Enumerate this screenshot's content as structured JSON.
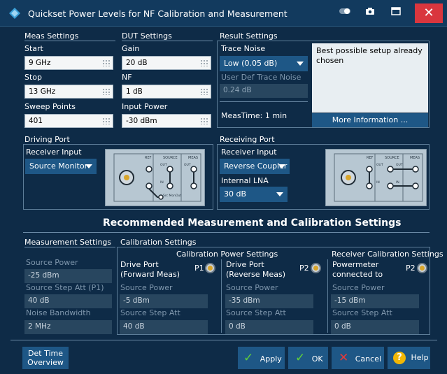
{
  "window": {
    "title": "Quickset Power Levels for NF Calibration and Measurement"
  },
  "meas": {
    "section": "Meas Settings",
    "start_label": "Start",
    "start_value": "9 GHz",
    "stop_label": "Stop",
    "stop_value": "13 GHz",
    "points_label": "Sweep Points",
    "points_value": "401"
  },
  "dut": {
    "section": "DUT Settings",
    "gain_label": "Gain",
    "gain_value": "20 dB",
    "nf_label": "NF",
    "nf_value": "1 dB",
    "power_label": "Input Power",
    "power_value": "-30 dBm"
  },
  "result": {
    "section": "Result Settings",
    "trace_noise_label": "Trace Noise",
    "trace_noise_value": "Low (0.05 dB)",
    "user_def_label": "User Def Trace Noise",
    "user_def_value": "0.24 dB",
    "meas_time": "MeasTime: 1 min",
    "info_text": "Best possible setup already chosen",
    "more_info": "More Information ..."
  },
  "driving": {
    "section": "Driving Port",
    "receiver_input_label": "Receiver Input",
    "receiver_input_value": "Source Monitor",
    "diagram_labels": [
      "REF",
      "SOURCE",
      "MEAS",
      "OUT",
      "IN",
      "OUT",
      "Src MonOut"
    ]
  },
  "receiving": {
    "section": "Receiving Port",
    "receiver_input_label": "Receiver Input",
    "receiver_input_value": "Reverse Coupler",
    "lna_label": "Internal LNA",
    "lna_value": "30 dB",
    "diagram_labels": [
      "REF",
      "SOURCE",
      "MEAS",
      "OUT",
      "OUT",
      "IN",
      "IN"
    ]
  },
  "recommended": {
    "title": "Recommended Measurement and Calibration Settings"
  },
  "measurement_settings": {
    "section": "Measurement Settings",
    "source_power_label": "Source Power",
    "source_power_value": "-25 dBm",
    "step_att_label": "Source Step Att (P1)",
    "step_att_value": "40 dB",
    "noise_bw_label": "Noise Bandwidth",
    "noise_bw_value": "2 MHz"
  },
  "calibration": {
    "section": "Calibration Settings",
    "power_title": "Calibration Power Settings",
    "fwd_label": "Drive Port\n(Forward Meas)",
    "fwd_line1": "Drive Port",
    "fwd_line2": "(Forward Meas)",
    "fwd_port": "P1",
    "fwd_power_label": "Source Power",
    "fwd_power_value": "-5 dBm",
    "fwd_att_label": "Source Step Att",
    "fwd_att_value": "40 dB",
    "rev_line1": "Drive Port",
    "rev_line2": "(Reverse Meas)",
    "rev_port": "P2",
    "rev_power_label": "Source Power",
    "rev_power_value": "-35 dBm",
    "rev_att_label": "Source Step Att",
    "rev_att_value": "0 dB",
    "rx_title": "Receiver Calibration Settings",
    "rx_line1": "Powermeter",
    "rx_line2": "connected to",
    "rx_port": "P2",
    "rx_power_label": "Source Power",
    "rx_power_value": "-15 dBm",
    "rx_att_label": "Source Step Att",
    "rx_att_value": "0 dB"
  },
  "buttons": {
    "det_time_line1": "Det Time",
    "det_time_line2": "Overview",
    "apply": "Apply",
    "ok": "OK",
    "cancel": "Cancel",
    "help": "Help"
  }
}
